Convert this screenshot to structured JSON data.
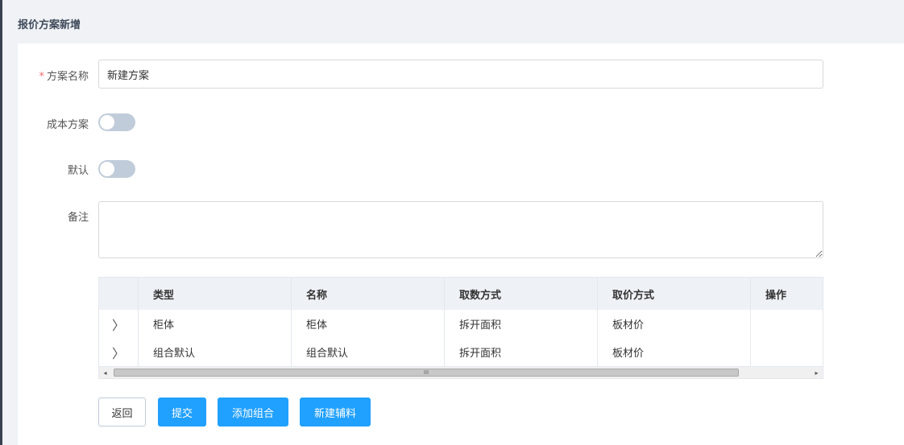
{
  "page": {
    "title": "报价方案新增"
  },
  "form": {
    "name": {
      "required_mark": "*",
      "label": "方案名称",
      "value": "新建方案"
    },
    "cost_plan": {
      "label": "成本方案",
      "on": false
    },
    "default": {
      "label": "默认",
      "on": false
    },
    "remark": {
      "label": "备注",
      "value": ""
    }
  },
  "table": {
    "headers": [
      "类型",
      "名称",
      "取数方式",
      "取价方式",
      "操作"
    ],
    "rows": [
      {
        "type": "柜体",
        "name": "柜体",
        "fetch_method": "拆开面积",
        "price_method": "板材价",
        "actions": ""
      },
      {
        "type": "组合默认",
        "name": "组合默认",
        "fetch_method": "拆开面积",
        "price_method": "板材价",
        "actions": ""
      }
    ],
    "expand_glyph": "〉",
    "scroll_left_glyph": "◂",
    "scroll_right_glyph": "▸",
    "scroll_grip": "III"
  },
  "buttons": {
    "back": "返回",
    "submit": "提交",
    "add_group": "添加组合",
    "new_material": "新建辅料"
  },
  "colors": {
    "primary": "#20a0ff",
    "required": "#f56c6c",
    "switch_off": "#c0ccda"
  }
}
